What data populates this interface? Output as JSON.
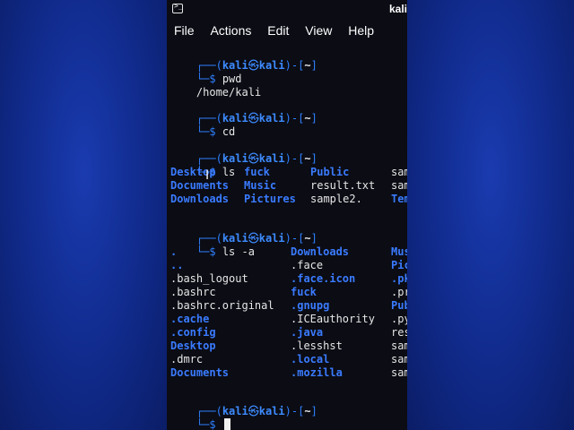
{
  "status": {
    "title": "kali"
  },
  "menu": [
    "File",
    "Actions",
    "Edit",
    "View",
    "Help"
  ],
  "prompt": {
    "top_left": "┌──(",
    "user": "kali",
    "at": "㉿",
    "host": "kali",
    "mid": ")-[",
    "dir": "~",
    "end": "]",
    "bottom": "└─$ "
  },
  "commands": {
    "pwd": "pwd",
    "pwd_output": "/home/kali",
    "cd": "cd",
    "ls": "ls",
    "ls_a": "ls -a"
  },
  "ls_output": {
    "col1": [
      {
        "name": "Desktop",
        "is_dir": true
      },
      {
        "name": "Documents",
        "is_dir": true
      },
      {
        "name": "Downloads",
        "is_dir": true
      }
    ],
    "col2": [
      {
        "name": "fuck",
        "is_dir": true
      },
      {
        "name": "Music",
        "is_dir": true
      },
      {
        "name": "Pictures",
        "is_dir": true
      }
    ],
    "col3": [
      {
        "name": "Public",
        "is_dir": true
      },
      {
        "name": "result.txt",
        "is_dir": false
      },
      {
        "name": "sample2.",
        "is_dir": false
      }
    ],
    "col4": [
      {
        "name": "sam",
        "is_dir": false
      },
      {
        "name": "sam",
        "is_dir": false
      },
      {
        "name": "Tem",
        "is_dir": true
      }
    ]
  },
  "ls_a_output": {
    "col1": [
      {
        "name": ".",
        "is_dir": true
      },
      {
        "name": "..",
        "is_dir": true
      },
      {
        "name": ".bash_logout",
        "is_dir": false
      },
      {
        "name": ".bashrc",
        "is_dir": false
      },
      {
        "name": ".bashrc.original",
        "is_dir": false
      },
      {
        "name": ".cache",
        "is_dir": true
      },
      {
        "name": ".config",
        "is_dir": true
      },
      {
        "name": "Desktop",
        "is_dir": true
      },
      {
        "name": ".dmrc",
        "is_dir": false
      },
      {
        "name": "Documents",
        "is_dir": true
      }
    ],
    "col2": [
      {
        "name": "Downloads",
        "is_dir": true
      },
      {
        "name": ".face",
        "is_dir": false
      },
      {
        "name": ".face.icon",
        "is_dir": true
      },
      {
        "name": "fuck",
        "is_dir": true
      },
      {
        "name": ".gnupg",
        "is_dir": true
      },
      {
        "name": ".ICEauthority",
        "is_dir": false
      },
      {
        "name": ".java",
        "is_dir": true
      },
      {
        "name": ".lesshst",
        "is_dir": false
      },
      {
        "name": ".local",
        "is_dir": true
      },
      {
        "name": ".mozilla",
        "is_dir": true
      }
    ],
    "col3": [
      {
        "name": "Mus",
        "is_dir": true
      },
      {
        "name": "Pic",
        "is_dir": true
      },
      {
        "name": ".pk",
        "is_dir": true
      },
      {
        "name": ".pr",
        "is_dir": false
      },
      {
        "name": "Pub",
        "is_dir": true
      },
      {
        "name": ".py",
        "is_dir": false
      },
      {
        "name": "res",
        "is_dir": false
      },
      {
        "name": "sam",
        "is_dir": false
      },
      {
        "name": "sam",
        "is_dir": false
      },
      {
        "name": "sam",
        "is_dir": false
      }
    ]
  },
  "colors": {
    "background": "#0e1f6e",
    "terminal_bg": "#0b0c14",
    "prompt_blue": "#2f80ff",
    "dir_blue": "#3a7bff",
    "text": "#e6e6e6"
  }
}
